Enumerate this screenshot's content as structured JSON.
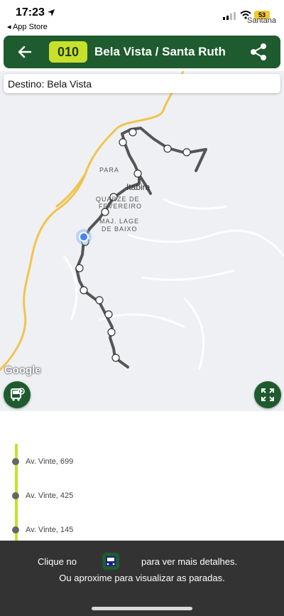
{
  "status_bar": {
    "time": "17:23",
    "back_app": "◂ App Store",
    "battery": "53",
    "carrier": "Santana"
  },
  "app_bar": {
    "route_number": "010",
    "route_name": "Bela Vista / Santa Ruth",
    "back_icon": "arrow-left-icon",
    "share_icon": "share-icon",
    "bar_color": "#1e5b2e",
    "badge_color": "#c9e02a"
  },
  "destination": {
    "text": "Destino: Bela Vista"
  },
  "map": {
    "labels": {
      "para": "PARA",
      "itabira": "Itabira",
      "quarze_l1": "QUARZE DE",
      "quarze_l2": "FEVEREIRO",
      "lage_l1": "MAJ. LAGE",
      "lage_l2": "DE BAIXO",
      "google": "Google"
    },
    "road_color": "#f0c44c",
    "route_color": "#555555"
  },
  "buttons": {
    "bus_icon": "bus-icon",
    "fullscreen_icon": "fullscreen-icon"
  },
  "stops": [
    {
      "name": "Av. Vinte, 699"
    },
    {
      "name": "Av. Vinte, 425"
    },
    {
      "name": "Av. Vinte, 145"
    }
  ],
  "bottom_sheet": {
    "line1_a": "Clique no",
    "line1_b": "para ver mais detalhes.",
    "line2": "Ou aproxime para visualizar as paradas."
  }
}
